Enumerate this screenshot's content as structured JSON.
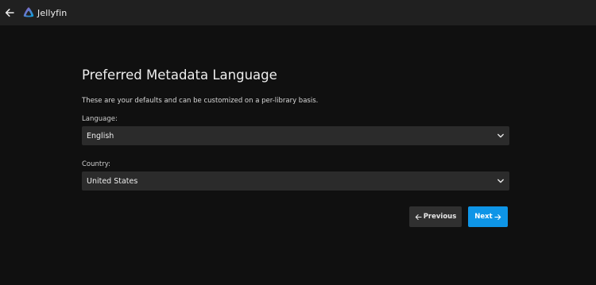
{
  "header": {
    "back_icon": "arrow-left-icon",
    "app_name": "Jellyfin",
    "logo_icon": "jellyfin-logo-icon",
    "background": "#202020"
  },
  "wizard": {
    "title": "Preferred Metadata Language",
    "description": "These are your defaults and can be customized on a per-library basis.",
    "language": {
      "label": "Language:",
      "value": "English",
      "icon": "chevron-down-icon"
    },
    "country": {
      "label": "Country:",
      "value": "United States",
      "icon": "chevron-down-icon"
    },
    "previous_button": {
      "label": "Previous",
      "icon": "arrow-left-icon",
      "color": "#303030"
    },
    "next_button": {
      "label": "Next",
      "icon": "arrow-right-icon",
      "color": "#0e95e7"
    }
  },
  "colors": {
    "page_background": "#101010",
    "field_background": "#2b2b2b",
    "accent": "#0e95e7",
    "logo_gradient_start": "#aa5cc3",
    "logo_gradient_end": "#00a4dc"
  }
}
